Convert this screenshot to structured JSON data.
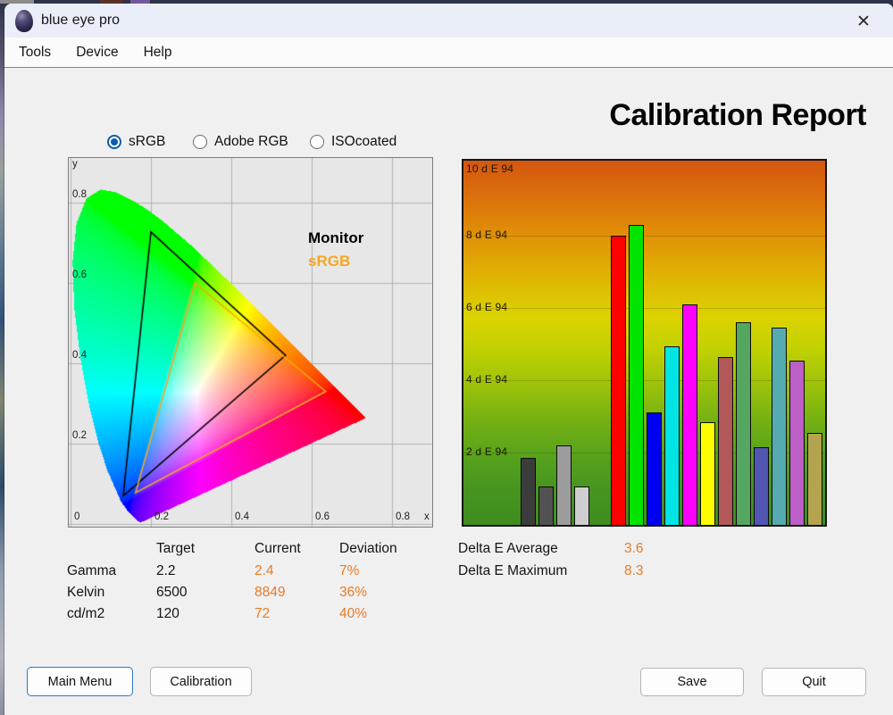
{
  "window": {
    "title": "blue eye pro",
    "close_glyph": "✕"
  },
  "menu": {
    "items": [
      "Tools",
      "Device",
      "Help"
    ]
  },
  "report": {
    "title": "Calibration Report"
  },
  "profiles": {
    "options": [
      {
        "label": "sRGB",
        "selected": true
      },
      {
        "label": "Adobe RGB",
        "selected": false
      },
      {
        "label": "ISOcoated",
        "selected": false
      }
    ]
  },
  "chart_data": [
    {
      "name": "cie-chromaticity-diagram",
      "type": "area",
      "xlabel": "x",
      "ylabel": "y",
      "xlim": [
        0,
        0.9
      ],
      "ylim": [
        0,
        0.915
      ],
      "x_ticks": [
        {
          "value": 0,
          "label": "0"
        },
        {
          "value": 0.2,
          "label": "0.2"
        },
        {
          "value": 0.4,
          "label": "0.4"
        },
        {
          "value": 0.6,
          "label": "0.6"
        },
        {
          "value": 0.8,
          "label": "0.8"
        }
      ],
      "y_ticks": [
        {
          "value": 0.2,
          "label": "0.2"
        },
        {
          "value": 0.4,
          "label": "0.4"
        },
        {
          "value": 0.6,
          "label": "0.6"
        },
        {
          "value": 0.8,
          "label": "0.8"
        }
      ],
      "grid": true,
      "legend_position": "upper-right",
      "legend": [
        {
          "label": "Monitor",
          "color": "#000000"
        },
        {
          "label": "sRGB",
          "color": "#f5a623"
        }
      ],
      "series": [
        {
          "name": "Monitor",
          "color": "#000000",
          "vertices": [
            [
              0.2,
              0.727
            ],
            [
              0.535,
              0.42
            ],
            [
              0.131,
              0.07
            ]
          ]
        },
        {
          "name": "sRGB",
          "color": "#f5a623",
          "vertices": [
            [
              0.31,
              0.6
            ],
            [
              0.635,
              0.33
            ],
            [
              0.162,
              0.078
            ]
          ]
        }
      ],
      "spectral_locus": [
        [
          0.1741,
          0.005
        ],
        [
          0.1714,
          0.0051
        ],
        [
          0.1689,
          0.0069
        ],
        [
          0.1644,
          0.0109
        ],
        [
          0.1566,
          0.0177
        ],
        [
          0.144,
          0.0297
        ],
        [
          0.1241,
          0.0578
        ],
        [
          0.0913,
          0.1327
        ],
        [
          0.0687,
          0.2007
        ],
        [
          0.0454,
          0.295
        ],
        [
          0.0235,
          0.4127
        ],
        [
          0.0082,
          0.5384
        ],
        [
          0.0039,
          0.6548
        ],
        [
          0.0139,
          0.7502
        ],
        [
          0.0389,
          0.812
        ],
        [
          0.0743,
          0.8338
        ],
        [
          0.1142,
          0.8262
        ],
        [
          0.1547,
          0.8059
        ],
        [
          0.1929,
          0.7816
        ],
        [
          0.2296,
          0.7543
        ],
        [
          0.3016,
          0.6923
        ],
        [
          0.3731,
          0.6245
        ],
        [
          0.4441,
          0.5547
        ],
        [
          0.5125,
          0.4866
        ],
        [
          0.5752,
          0.4242
        ],
        [
          0.627,
          0.3725
        ],
        [
          0.6658,
          0.334
        ],
        [
          0.6915,
          0.3083
        ],
        [
          0.719,
          0.2809
        ],
        [
          0.7347,
          0.2653
        ]
      ]
    },
    {
      "name": "delta-e-report-bars",
      "type": "bar",
      "ylim": [
        0,
        10
      ],
      "y_ticks": [
        {
          "value": 10,
          "label": "10 d E 94"
        },
        {
          "value": 8,
          "label": "8 d E 94"
        },
        {
          "value": 6,
          "label": "6 d E 94"
        },
        {
          "value": 4,
          "label": "4 d E 94"
        },
        {
          "value": 2,
          "label": "2 d E 94"
        }
      ],
      "bars": [
        {
          "value": 1.85,
          "color": "#3c3c3c"
        },
        {
          "value": 1.05,
          "color": "#525252"
        },
        {
          "value": 2.2,
          "color": "#9c9c9c"
        },
        {
          "value": 1.05,
          "color": "#cfcfcf"
        },
        {
          "value": 8.0,
          "color": "#fe0000"
        },
        {
          "value": 8.3,
          "color": "#00e400"
        },
        {
          "value": 3.1,
          "color": "#0000f0"
        },
        {
          "value": 4.95,
          "color": "#00e4e4"
        },
        {
          "value": 6.1,
          "color": "#ff00fe"
        },
        {
          "value": 2.85,
          "color": "#fdfd00"
        },
        {
          "value": 4.65,
          "color": "#b25858"
        },
        {
          "value": 5.6,
          "color": "#53a75e"
        },
        {
          "value": 2.15,
          "color": "#5156b2"
        },
        {
          "value": 5.45,
          "color": "#55abb0"
        },
        {
          "value": 4.55,
          "color": "#bc5fc6"
        },
        {
          "value": 2.55,
          "color": "#b5a44f"
        }
      ]
    }
  ],
  "measurements": {
    "headers": {
      "target": "Target",
      "current": "Current",
      "deviation": "Deviation"
    },
    "rows": [
      {
        "label": "Gamma",
        "target": "2.2",
        "current": "2.4",
        "deviation": "7%"
      },
      {
        "label": "Kelvin",
        "target": "6500",
        "current": "8849",
        "deviation": "36%"
      },
      {
        "label": "cd/m2",
        "target": "120",
        "current": "72",
        "deviation": "40%"
      }
    ]
  },
  "delta_e": {
    "average_label": "Delta E Average",
    "average_value": "3.6",
    "maximum_label": "Delta E Maximum",
    "maximum_value": "8.3"
  },
  "buttons": {
    "main_menu": "Main Menu",
    "calibration": "Calibration",
    "save": "Save",
    "quit": "Quit"
  },
  "colors": {
    "accent_orange": "#e87b28"
  }
}
